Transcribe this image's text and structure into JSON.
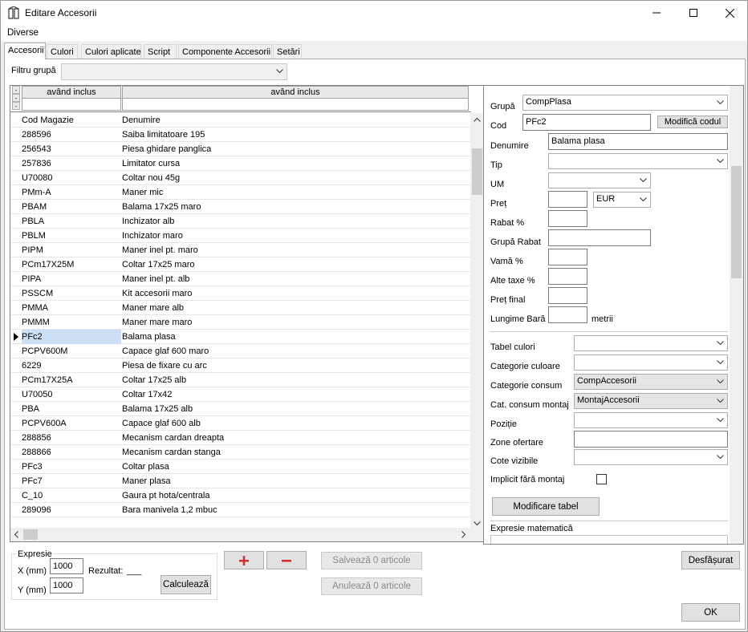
{
  "window": {
    "title": "Editare Accesorii",
    "minimize_icon": "minimize-icon",
    "maximize_icon": "maximize-icon",
    "close_icon": "close-icon"
  },
  "menu": {
    "diverse": "Diverse"
  },
  "tabs": [
    "Accesorii",
    "Culori",
    "Culori aplicate",
    "Script",
    "Componente Accesorii",
    "Setări"
  ],
  "filter": {
    "label": "Filtru grupă",
    "value": ""
  },
  "grid": {
    "filter_headers": [
      "având inclus",
      "având inclus"
    ],
    "columns": [
      "Cod Magazie",
      "Denumire"
    ],
    "rows": [
      [
        "288596",
        "Saiba limitatoare 195"
      ],
      [
        "256543",
        "Piesa ghidare panglica"
      ],
      [
        "257836",
        "Limitator cursa"
      ],
      [
        "U70080",
        "Coltar nou 45g"
      ],
      [
        "PMm-A",
        "Maner mic"
      ],
      [
        "PBAM",
        "Balama 17x25 maro"
      ],
      [
        "PBLA",
        "Inchizator alb"
      ],
      [
        "PBLM",
        "Inchizator maro"
      ],
      [
        "PIPM",
        "Maner inel pt. maro"
      ],
      [
        "PCm17X25M",
        "Coltar 17x25 maro"
      ],
      [
        "PIPA",
        "Maner inel pt. alb"
      ],
      [
        "PSSCM",
        "Kit accesorii maro"
      ],
      [
        "PMMA",
        "Maner mare alb"
      ],
      [
        "PMMM",
        "Maner mare maro"
      ],
      [
        "PFc2",
        "Balama plasa"
      ],
      [
        "PCPV600M",
        "Capace glaf 600 maro"
      ],
      [
        "6229",
        "Piesa de fixare cu arc"
      ],
      [
        "PCm17X25A",
        "Coltar 17x25 alb"
      ],
      [
        "U70050",
        "Coltar 17x42"
      ],
      [
        "PBA",
        "Balama 17x25 alb"
      ],
      [
        "PCPV600A",
        "Capace glaf 600 alb"
      ],
      [
        "288856",
        "Mecanism cardan dreapta"
      ],
      [
        "288866",
        "Mecanism cardan stanga"
      ],
      [
        "PFc3",
        "Coltar plasa"
      ],
      [
        "PFc7",
        "Maner plasa"
      ],
      [
        "C_10",
        "Gaura pt hota/centrala"
      ],
      [
        "289096",
        "Bara manivela 1,2 mbuc"
      ]
    ],
    "selected_index": 14
  },
  "details": {
    "grupa_label": "Grupă",
    "grupa_value": "CompPlasa",
    "cod_label": "Cod",
    "cod_value": "PFc2",
    "modifica_codul": "Modifică codul",
    "denumire_label": "Denumire",
    "denumire_value": "Balama plasa",
    "tip_label": "Tip",
    "tip_value": "",
    "um_label": "UM",
    "um_value": "",
    "pret_label": "Preț",
    "pret_value": "",
    "currency": "EUR",
    "rabat_label": "Rabat %",
    "rabat_value": "",
    "grupa_rabat_label": "Grupă Rabat",
    "grupa_rabat_value": "",
    "vama_label": "Vamă %",
    "vama_value": "",
    "alte_taxe_label": "Alte taxe %",
    "alte_taxe_value": "",
    "pret_final_label": "Preț final",
    "pret_final_value": "",
    "lungime_bara_label": "Lungime Bară",
    "lungime_bara_value": "",
    "metrii": "metrii",
    "tabel_culori_label": "Tabel culori",
    "tabel_culori_value": "",
    "categorie_culoare_label": "Categorie culoare",
    "categorie_culoare_value": "",
    "categorie_consum_label": "Categorie consum",
    "categorie_consum_value": "CompAccesorii",
    "cat_consum_montaj_label": "Cat. consum montaj",
    "cat_consum_montaj_value": "MontajAccesorii",
    "pozitie_label": "Poziție",
    "pozitie_value": "",
    "zone_ofertare_label": "Zone ofertare",
    "zone_ofertare_value": "",
    "cote_vizibile_label": "Cote vizibile",
    "cote_vizibile_value": "",
    "implicit_fara_montaj_label": "Implicit fără montaj",
    "implicit_fara_montaj_checked": false,
    "modificare_tabel": "Modificare tabel",
    "expresie_matematica_label": "Expresie matematică"
  },
  "bottom": {
    "expresie_legend": "Expresie",
    "x_label": "X (mm)",
    "x_value": "1000",
    "y_label": "Y (mm)",
    "y_value": "1000",
    "rezultat_label": "Rezultat:",
    "rezultat_value": "___",
    "calculeaza": "Calculează",
    "add_symbol": "+",
    "remove_symbol": "−",
    "salveaza": "Salvează 0 articole",
    "anuleaza": "Anulează 0 articole",
    "desfasurat": "Desfășurat",
    "ok": "OK"
  }
}
